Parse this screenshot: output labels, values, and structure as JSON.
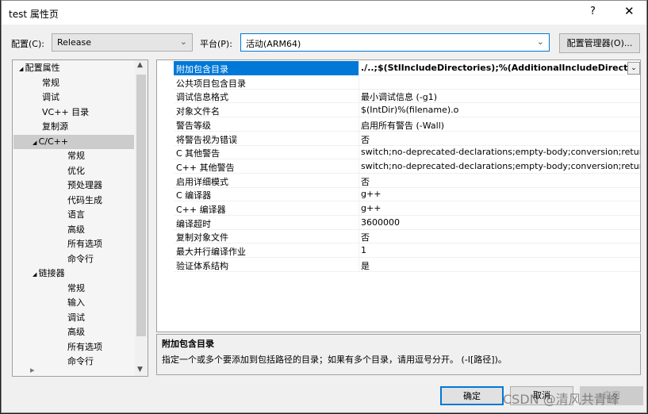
{
  "window": {
    "title": "test 属性页",
    "help": "?",
    "close": "✕"
  },
  "config": {
    "label": "配置(C):",
    "value": "Release",
    "platform_label": "平台(P):",
    "platform_value": "活动(ARM64)",
    "manager_button": "配置管理器(O)..."
  },
  "tree": [
    {
      "label": "配置属性",
      "level": 0,
      "expanded": true
    },
    {
      "label": "常规",
      "level": 1
    },
    {
      "label": "调试",
      "level": 1
    },
    {
      "label": "VC++ 目录",
      "level": 1
    },
    {
      "label": "复制源",
      "level": 1
    },
    {
      "label": "C/C++",
      "level": 1,
      "expanded": true,
      "selected": true
    },
    {
      "label": "常规",
      "level": 2
    },
    {
      "label": "优化",
      "level": 2
    },
    {
      "label": "预处理器",
      "level": 2
    },
    {
      "label": "代码生成",
      "level": 2
    },
    {
      "label": "语言",
      "level": 2
    },
    {
      "label": "高级",
      "level": 2
    },
    {
      "label": "所有选项",
      "level": 2
    },
    {
      "label": "命令行",
      "level": 2
    },
    {
      "label": "链接器",
      "level": 1,
      "expanded": true
    },
    {
      "label": "常规",
      "level": 2
    },
    {
      "label": "输入",
      "level": 2
    },
    {
      "label": "调试",
      "level": 2
    },
    {
      "label": "高级",
      "level": 2
    },
    {
      "label": "所有选项",
      "level": 2
    },
    {
      "label": "命令行",
      "level": 2
    }
  ],
  "properties": [
    {
      "name": "附加包含目录",
      "value": "./..;$(StlIncludeDirectories);%(AdditionalIncludeDirectories)",
      "selected": true
    },
    {
      "name": "公共项目包含目录",
      "value": ""
    },
    {
      "name": "调试信息格式",
      "value": "最小调试信息 (-g1)"
    },
    {
      "name": "对象文件名",
      "value": "$(IntDir)%(filename).o"
    },
    {
      "name": "警告等级",
      "value": "启用所有警告 (-Wall)"
    },
    {
      "name": "将警告视为错误",
      "value": "否"
    },
    {
      "name": "C 其他警告",
      "value": "switch;no-deprecated-declarations;empty-body;conversion;return-type"
    },
    {
      "name": "C++ 其他警告",
      "value": "switch;no-deprecated-declarations;empty-body;conversion;return-type"
    },
    {
      "name": "启用详细模式",
      "value": "否"
    },
    {
      "name": "C 编译器",
      "value": "g++"
    },
    {
      "name": "C++ 编译器",
      "value": "g++"
    },
    {
      "name": "编译超时",
      "value": "3600000"
    },
    {
      "name": "复制对象文件",
      "value": "否"
    },
    {
      "name": "最大并行编译作业",
      "value": "1"
    },
    {
      "name": "验证体系结构",
      "value": "是"
    }
  ],
  "description": {
    "title": "附加包含目录",
    "text": "指定一个或多个要添加到包括路径的目录；如果有多个目录，请用逗号分开。   (-I[路径])。"
  },
  "buttons": {
    "ok": "确定",
    "cancel": "取消",
    "apply": "应用"
  },
  "watermark": "CSDN @清风共青峰"
}
